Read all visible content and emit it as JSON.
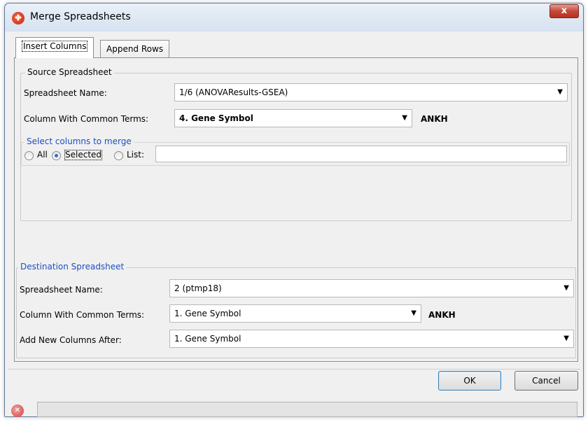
{
  "window": {
    "title": "Merge Spreadsheets",
    "close_glyph": "x"
  },
  "tabs": [
    {
      "label": "Insert Columns",
      "active": true
    },
    {
      "label": "Append Rows",
      "active": false
    }
  ],
  "source": {
    "legend": "Source Spreadsheet",
    "spreadsheet_name_label": "Spreadsheet Name:",
    "spreadsheet_name_value": "1/6 (ANOVAResults-GSEA)",
    "common_terms_label": "Column With Common Terms:",
    "common_terms_value": "4. Gene Symbol",
    "common_terms_example": "ANKH",
    "select_legend": "Select columns to merge",
    "radio_all": "All",
    "radio_selected": "Selected",
    "radio_list": "List:",
    "list_value": ""
  },
  "destination": {
    "legend": "Destination Spreadsheet",
    "spreadsheet_name_label": "Spreadsheet Name:",
    "spreadsheet_name_value": "2 (ptmp18)",
    "common_terms_label": "Column With Common Terms:",
    "common_terms_value": "1. Gene Symbol",
    "common_terms_example": "ANKH",
    "add_after_label": "Add New Columns After:",
    "add_after_value": "1. Gene Symbol"
  },
  "buttons": {
    "ok": "OK",
    "cancel": "Cancel"
  },
  "status": {
    "text": ""
  },
  "colors": {
    "legend_blue": "#1d4fc4",
    "radio_checked": "#2a6fd1"
  }
}
